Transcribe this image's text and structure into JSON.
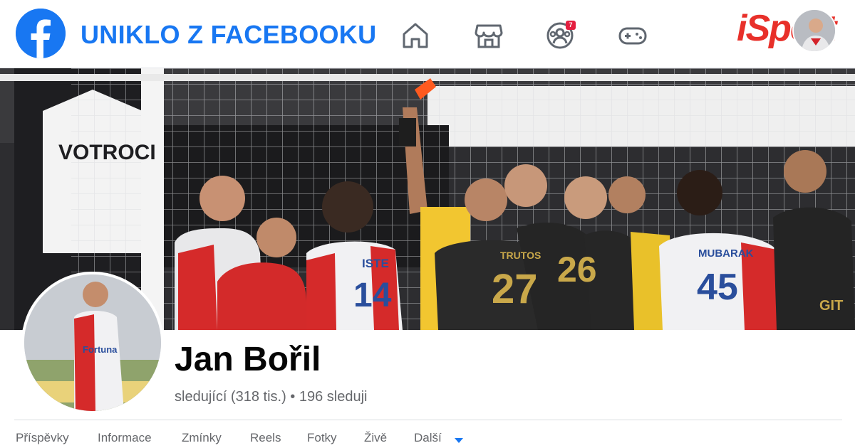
{
  "header": {
    "title": "UNIKLO Z FACEBOOKU",
    "logo_icon": "facebook-logo-icon",
    "brand_logo": "iSport",
    "accent_color": "#1877f2",
    "nav_icons": [
      "home-icon",
      "marketplace-icon",
      "groups-icon",
      "gaming-icon"
    ],
    "groups_badge": "7"
  },
  "profile": {
    "name": "Jan Bořil",
    "followers_text": "sledující (318 tis.)",
    "separator": "•",
    "following_text": "196 sleduji"
  },
  "tabs": [
    {
      "label": "Příspěvky"
    },
    {
      "label": "Informace"
    },
    {
      "label": "Zmínky"
    },
    {
      "label": "Reels"
    },
    {
      "label": "Fotky"
    },
    {
      "label": "Živě"
    },
    {
      "label": "Další"
    }
  ],
  "cover": {
    "banner_text": "VOTROCI",
    "jersey_numbers": [
      "14",
      "27",
      "26",
      "45"
    ],
    "jersey_names": [
      "ISTE",
      "TRUTOS",
      "MUBARAK"
    ],
    "sponsor_text": "GIT"
  }
}
